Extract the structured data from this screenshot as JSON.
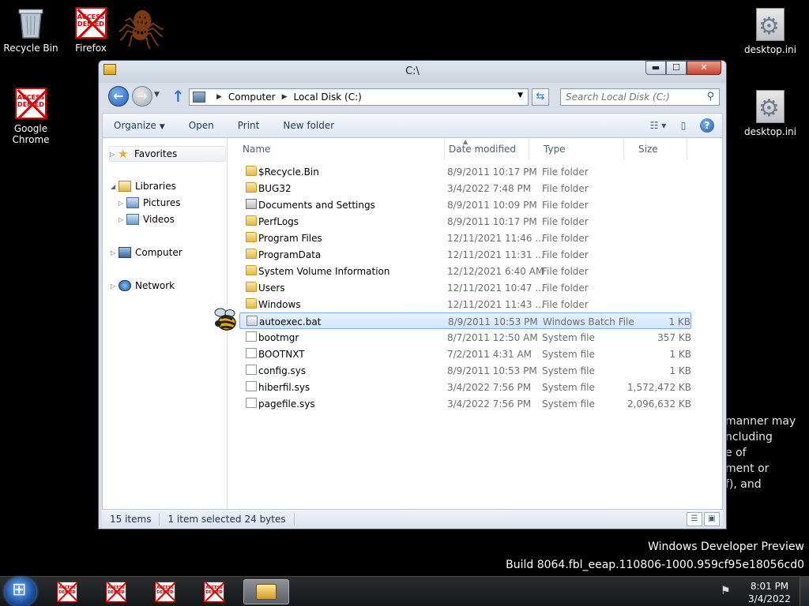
{
  "desktop": {
    "icons": [
      {
        "label": "Recycle Bin"
      },
      {
        "label": "Firefox",
        "badge": "ACCESS DENIED"
      },
      {
        "label": "Google Chrome",
        "badge": "ACCESS DENIED"
      },
      {
        "label": "desktop.ini"
      },
      {
        "label": "desktop.ini"
      }
    ],
    "legal_text": "manner may\nncluding\ne of\nment or\nf), and",
    "watermark_line1": "Windows Developer Preview",
    "watermark_line2": "Build 8064.fbl_eeap.110806-1000.959cf95e18056cd0"
  },
  "window": {
    "title": "C:\\",
    "controls": {
      "minimize": "▬",
      "maximize": "☐",
      "close": "✕"
    },
    "breadcrumb": [
      "Computer",
      "Local Disk (C:)"
    ],
    "search_placeholder": "Search Local Disk (C:)",
    "commands": {
      "organize": "Organize",
      "open": "Open",
      "print": "Print",
      "new_folder": "New folder"
    },
    "nav": {
      "favorites": "Favorites",
      "libraries": "Libraries",
      "pictures": "Pictures",
      "videos": "Videos",
      "computer": "Computer",
      "network": "Network"
    },
    "columns": {
      "name": "Name",
      "date_modified": "Date modified",
      "type": "Type",
      "size": "Size"
    },
    "files": [
      {
        "name": "$Recycle.Bin",
        "date": "8/9/2011 10:17 PM",
        "type": "File folder",
        "size": "",
        "icon": "folder-icon"
      },
      {
        "name": "BUG32",
        "date": "3/4/2022 7:48 PM",
        "type": "File folder",
        "size": "",
        "icon": "folder-icon"
      },
      {
        "name": "Documents and Settings",
        "date": "8/9/2011 10:09 PM",
        "type": "File folder",
        "size": "",
        "icon": "shortcut-folder-icon"
      },
      {
        "name": "PerfLogs",
        "date": "8/9/2011 10:17 PM",
        "type": "File folder",
        "size": "",
        "icon": "folder-icon"
      },
      {
        "name": "Program Files",
        "date": "12/11/2021 11:46 ...",
        "type": "File folder",
        "size": "",
        "icon": "folder-icon"
      },
      {
        "name": "ProgramData",
        "date": "12/11/2021 11:31 ...",
        "type": "File folder",
        "size": "",
        "icon": "folder-icon"
      },
      {
        "name": "System Volume Information",
        "date": "12/12/2021 6:40 AM",
        "type": "File folder",
        "size": "",
        "icon": "folder-icon"
      },
      {
        "name": "Users",
        "date": "12/11/2021 10:47 ...",
        "type": "File folder",
        "size": "",
        "icon": "folder-icon"
      },
      {
        "name": "Windows",
        "date": "12/11/2021 11:43 ...",
        "type": "File folder",
        "size": "",
        "icon": "folder-icon"
      },
      {
        "name": "autoexec.bat",
        "date": "8/9/2011 10:53 PM",
        "type": "Windows Batch File",
        "size": "1 KB",
        "icon": "batch-file-icon",
        "selected": true
      },
      {
        "name": "bootmgr",
        "date": "8/7/2011 12:50 AM",
        "type": "System file",
        "size": "357 KB",
        "icon": "file-icon"
      },
      {
        "name": "BOOTNXT",
        "date": "7/2/2011 4:31 AM",
        "type": "System file",
        "size": "1 KB",
        "icon": "file-icon"
      },
      {
        "name": "config.sys",
        "date": "8/9/2011 10:53 PM",
        "type": "System file",
        "size": "1 KB",
        "icon": "file-icon"
      },
      {
        "name": "hiberfil.sys",
        "date": "3/4/2022 7:56 PM",
        "type": "System file",
        "size": "1,572,472 KB",
        "icon": "file-icon"
      },
      {
        "name": "pagefile.sys",
        "date": "3/4/2022 7:56 PM",
        "type": "System file",
        "size": "2,096,632 KB",
        "icon": "file-icon"
      }
    ],
    "status": {
      "items": "15 items",
      "selected": "1 item selected",
      "size": "24 bytes"
    }
  },
  "taskbar": {
    "pinned_badge": "ACCESS DENIED",
    "time": "8:01 PM",
    "date": "3/4/2022"
  }
}
